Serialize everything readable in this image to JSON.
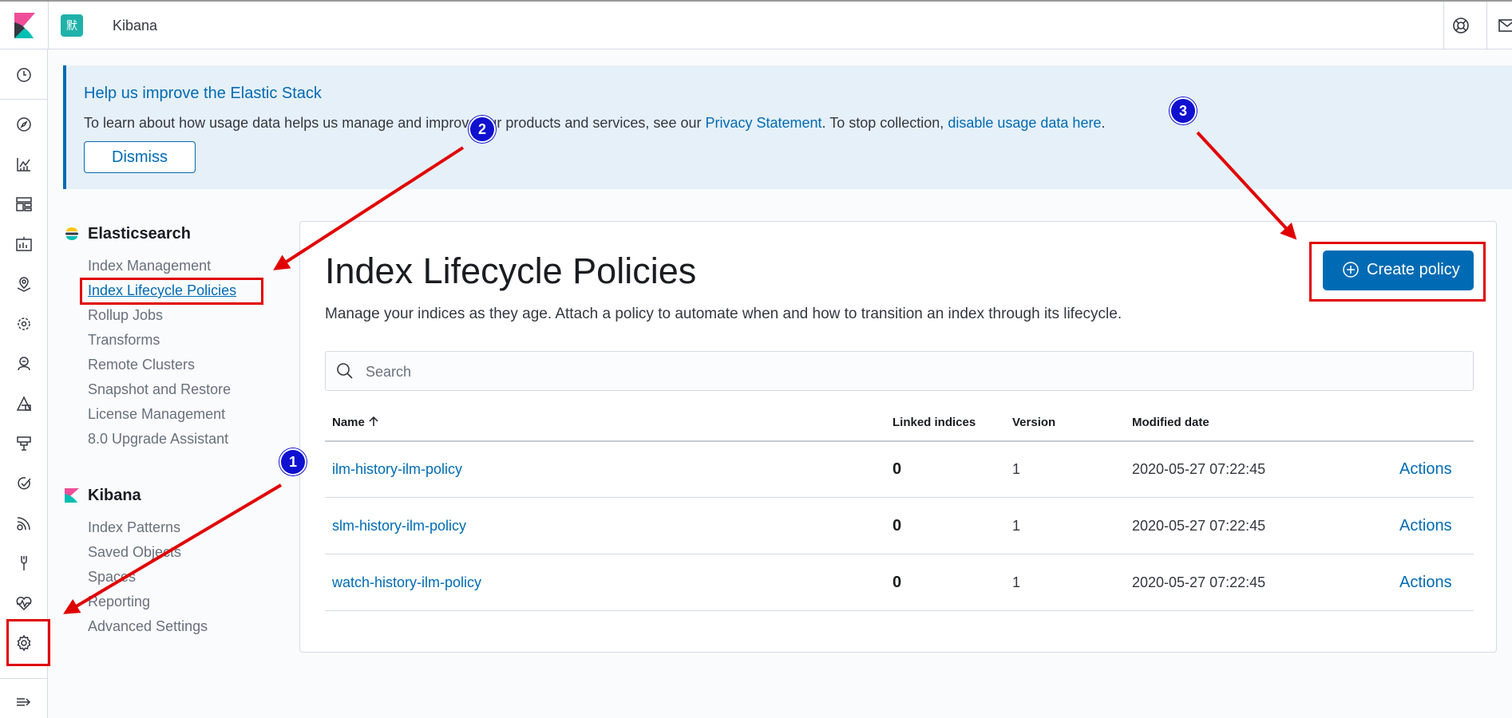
{
  "header": {
    "app_title": "Kibana",
    "space_initial": "默"
  },
  "callout": {
    "title": "Help us improve the Elastic Stack",
    "text_before": "To learn about how usage data helps us manage and improve our products and services, see our ",
    "privacy_link": "Privacy Statement",
    "text_middle": ". To stop collection, ",
    "disable_link": "disable usage data here",
    "text_after": ".",
    "dismiss_label": "Dismiss"
  },
  "sidebar": {
    "elasticsearch": {
      "title": "Elasticsearch",
      "items": [
        "Index Management",
        "Index Lifecycle Policies",
        "Rollup Jobs",
        "Transforms",
        "Remote Clusters",
        "Snapshot and Restore",
        "License Management",
        "8.0 Upgrade Assistant"
      ]
    },
    "kibana": {
      "title": "Kibana",
      "items": [
        "Index Patterns",
        "Saved Objects",
        "Spaces",
        "Reporting",
        "Advanced Settings"
      ]
    }
  },
  "main": {
    "title": "Index Lifecycle Policies",
    "description": "Manage your indices as they age. Attach a policy to automate when and how to transition an index through its lifecycle.",
    "create_button": "Create policy",
    "search_placeholder": "Search",
    "columns": [
      "Name",
      "Linked indices",
      "Version",
      "Modified date"
    ],
    "rows": [
      {
        "name": "ilm-history-ilm-policy",
        "linked": "0",
        "version": "1",
        "modified": "2020-05-27 07:22:45",
        "action": "Actions"
      },
      {
        "name": "slm-history-ilm-policy",
        "linked": "0",
        "version": "1",
        "modified": "2020-05-27 07:22:45",
        "action": "Actions"
      },
      {
        "name": "watch-history-ilm-policy",
        "linked": "0",
        "version": "1",
        "modified": "2020-05-27 07:22:45",
        "action": "Actions"
      }
    ]
  },
  "annotations": {
    "badges": [
      "1",
      "2",
      "3"
    ]
  },
  "colors": {
    "accent": "#006bb4",
    "annotation_red": "#e00000",
    "badge_blue": "#1010d0"
  }
}
